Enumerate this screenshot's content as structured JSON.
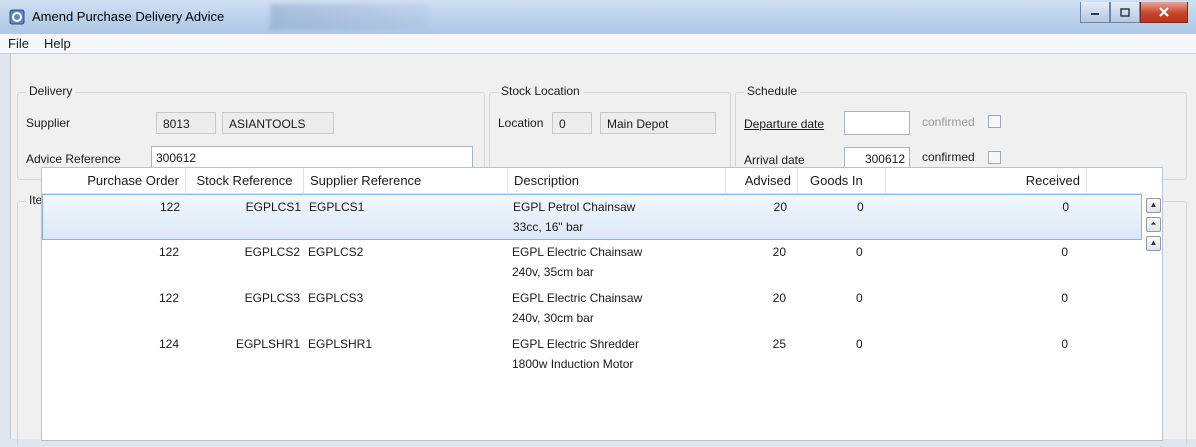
{
  "window": {
    "title": "Amend Purchase Delivery Advice"
  },
  "menu": {
    "file": "File",
    "help": "Help"
  },
  "delivery": {
    "group_title": "Delivery",
    "supplier_label": "Supplier",
    "supplier_code": "8013",
    "supplier_name": "ASIANTOOLS",
    "advice_label": "Advice Reference",
    "advice_value": "300612"
  },
  "stock_location": {
    "group_title": "Stock Location",
    "location_label": "Location",
    "location_code": "0",
    "location_name": "Main Depot"
  },
  "schedule": {
    "group_title": "Schedule",
    "departure_label": "Departure date",
    "departure_value": "",
    "departure_confirmed_label": "confirmed",
    "arrival_label": "Arrival date",
    "arrival_value": "300612",
    "arrival_confirmed_label": "confirmed"
  },
  "item_list": {
    "group_title": "Item List",
    "columns": [
      "Purchase Order",
      "Stock Reference",
      "Supplier Reference",
      "Description",
      "Advised",
      "Goods In",
      "Received"
    ],
    "rows": [
      {
        "po": "122",
        "stock_ref": "EGPLCS1",
        "supplier_ref": "EGPLCS1",
        "desc1": "EGPL Petrol Chainsaw",
        "desc2": "33cc, 16\" bar",
        "advised": "20",
        "goods_in": "0",
        "received": "0"
      },
      {
        "po": "122",
        "stock_ref": "EGPLCS2",
        "supplier_ref": "EGPLCS2",
        "desc1": "EGPL Electric Chainsaw",
        "desc2": "240v, 35cm bar",
        "advised": "20",
        "goods_in": "0",
        "received": "0"
      },
      {
        "po": "122",
        "stock_ref": "EGPLCS3",
        "supplier_ref": "EGPLCS3",
        "desc1": "EGPL Electric Chainsaw",
        "desc2": "240v, 30cm bar",
        "advised": "20",
        "goods_in": "0",
        "received": "0"
      },
      {
        "po": "124",
        "stock_ref": "EGPLSHR1",
        "supplier_ref": "EGPLSHR1",
        "desc1": "EGPL Electric Shredder",
        "desc2": "1800w Induction Motor",
        "advised": "25",
        "goods_in": "0",
        "received": "0"
      }
    ]
  }
}
